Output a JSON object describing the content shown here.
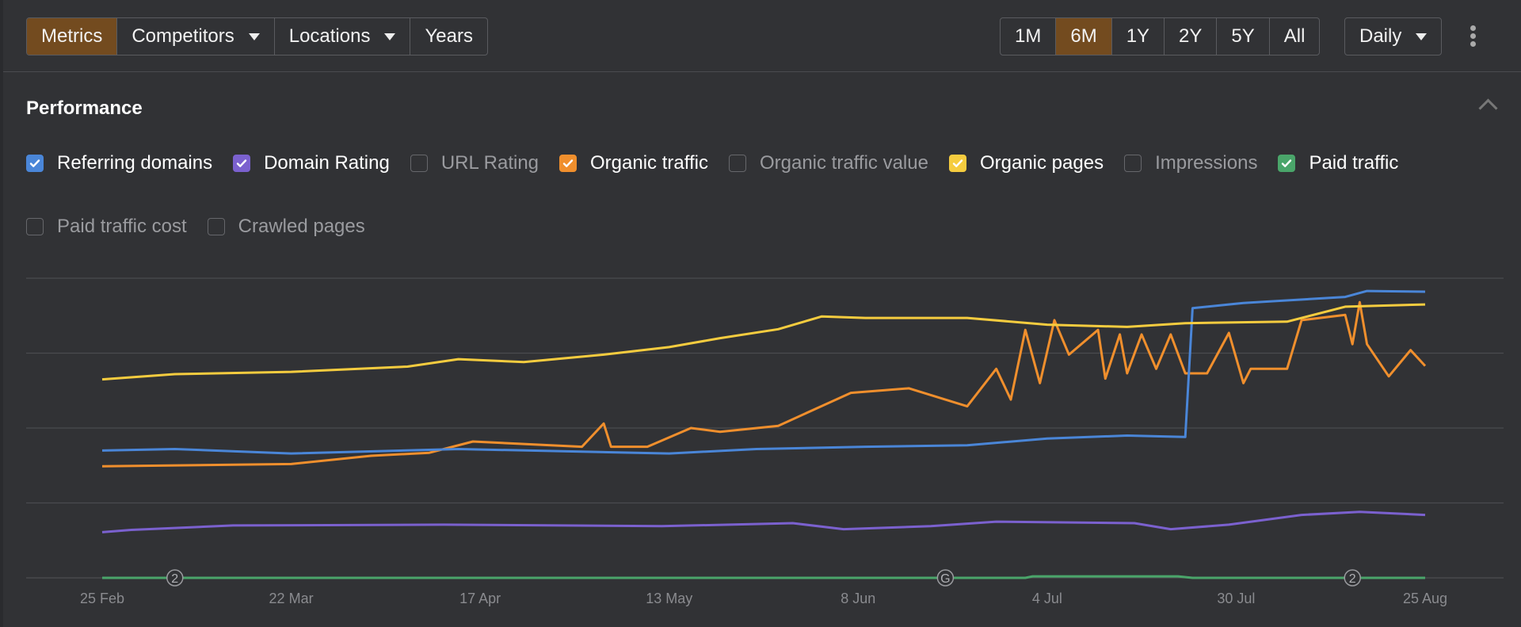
{
  "toolbar": {
    "left_buttons": [
      {
        "label": "Metrics",
        "active": true,
        "dropdown": false
      },
      {
        "label": "Competitors",
        "active": false,
        "dropdown": true
      },
      {
        "label": "Locations",
        "active": false,
        "dropdown": true
      },
      {
        "label": "Years",
        "active": false,
        "dropdown": false
      }
    ],
    "ranges": [
      {
        "label": "1M",
        "active": false
      },
      {
        "label": "6M",
        "active": true
      },
      {
        "label": "1Y",
        "active": false
      },
      {
        "label": "2Y",
        "active": false
      },
      {
        "label": "5Y",
        "active": false
      },
      {
        "label": "All",
        "active": false
      }
    ],
    "interval": "Daily",
    "more_icon": "kebab-vertical-icon"
  },
  "section": {
    "title": "Performance",
    "collapse_icon": "chevron-up-icon"
  },
  "metrics": [
    {
      "label": "Referring domains",
      "checked": true,
      "color": "#4a86d8"
    },
    {
      "label": "Domain Rating",
      "checked": true,
      "color": "#7b61cf"
    },
    {
      "label": "URL Rating",
      "checked": false,
      "color": ""
    },
    {
      "label": "Organic traffic",
      "checked": true,
      "color": "#f08f2d"
    },
    {
      "label": "Organic traffic value",
      "checked": false,
      "color": ""
    },
    {
      "label": "Organic pages",
      "checked": true,
      "color": "#f5cc3f"
    },
    {
      "label": "Impressions",
      "checked": false,
      "color": ""
    },
    {
      "label": "Paid traffic",
      "checked": true,
      "color": "#4aa56a"
    },
    {
      "label": "Paid traffic cost",
      "checked": false,
      "color": ""
    },
    {
      "label": "Crawled pages",
      "checked": false,
      "color": ""
    }
  ],
  "chart_data": {
    "type": "line",
    "grid": true,
    "y_axis_labels": false,
    "ylim": [
      0,
      4
    ],
    "x_ticks": [
      "25 Feb",
      "22 Mar",
      "17 Apr",
      "13 May",
      "8 Jun",
      "4 Jul",
      "30 Jul",
      "25 Aug"
    ],
    "series": [
      {
        "metric": "Organic pages",
        "color": "#f5cc3f",
        "points": [
          [
            "25 Feb",
            2.65
          ],
          [
            "6 Mar",
            2.72
          ],
          [
            "22 Mar",
            2.75
          ],
          [
            "7 Apr",
            2.82
          ],
          [
            "14 Apr",
            2.92
          ],
          [
            "23 Apr",
            2.88
          ],
          [
            "4 May",
            2.98
          ],
          [
            "13 May",
            3.08
          ],
          [
            "20 May",
            3.2
          ],
          [
            "28 May",
            3.32
          ],
          [
            "3 Jun",
            3.49
          ],
          [
            "9 Jun",
            3.47
          ],
          [
            "23 Jun",
            3.47
          ],
          [
            "4 Jul",
            3.38
          ],
          [
            "15 Jul",
            3.35
          ],
          [
            "23 Jul",
            3.4
          ],
          [
            "6 Aug",
            3.42
          ],
          [
            "14 Aug",
            3.62
          ],
          [
            "25 Aug",
            3.65
          ]
        ]
      },
      {
        "metric": "Referring domains",
        "color": "#4a86d8",
        "points": [
          [
            "25 Feb",
            1.7
          ],
          [
            "6 Mar",
            1.72
          ],
          [
            "22 Mar",
            1.66
          ],
          [
            "14 Apr",
            1.72
          ],
          [
            "13 May",
            1.66
          ],
          [
            "25 May",
            1.72
          ],
          [
            "9 Jun",
            1.75
          ],
          [
            "23 Jun",
            1.77
          ],
          [
            "4 Jul",
            1.86
          ],
          [
            "15 Jul",
            1.9
          ],
          [
            "23 Jul",
            1.88
          ],
          [
            "24 Jul",
            3.6
          ],
          [
            "31 Jul",
            3.67
          ],
          [
            "14 Aug",
            3.75
          ],
          [
            "17 Aug",
            3.83
          ],
          [
            "25 Aug",
            3.82
          ]
        ]
      },
      {
        "metric": "Organic traffic",
        "color": "#f08f2d",
        "points": [
          [
            "25 Feb",
            1.49
          ],
          [
            "22 Mar",
            1.52
          ],
          [
            "2 Apr",
            1.63
          ],
          [
            "10 Apr",
            1.67
          ],
          [
            "16 Apr",
            1.82
          ],
          [
            "1 May",
            1.75
          ],
          [
            "4 May",
            2.06
          ],
          [
            "5 May",
            1.75
          ],
          [
            "10 May",
            1.75
          ],
          [
            "16 May",
            2.0
          ],
          [
            "20 May",
            1.95
          ],
          [
            "28 May",
            2.03
          ],
          [
            "7 Jun",
            2.47
          ],
          [
            "15 Jun",
            2.53
          ],
          [
            "23 Jun",
            2.29
          ],
          [
            "27 Jun",
            2.79
          ],
          [
            "29 Jun",
            2.38
          ],
          [
            "1 Jul",
            3.31
          ],
          [
            "3 Jul",
            2.6
          ],
          [
            "5 Jul",
            3.44
          ],
          [
            "7 Jul",
            2.98
          ],
          [
            "11 Jul",
            3.31
          ],
          [
            "12 Jul",
            2.66
          ],
          [
            "14 Jul",
            3.25
          ],
          [
            "15 Jul",
            2.73
          ],
          [
            "17 Jul",
            3.25
          ],
          [
            "19 Jul",
            2.79
          ],
          [
            "21 Jul",
            3.25
          ],
          [
            "23 Jul",
            2.73
          ],
          [
            "26 Jul",
            2.73
          ],
          [
            "29 Jul",
            3.27
          ],
          [
            "31 Jul",
            2.6
          ],
          [
            "1 Aug",
            2.79
          ],
          [
            "6 Aug",
            2.79
          ],
          [
            "8 Aug",
            3.44
          ],
          [
            "14 Aug",
            3.51
          ],
          [
            "15 Aug",
            3.12
          ],
          [
            "16 Aug",
            3.68
          ],
          [
            "17 Aug",
            3.12
          ],
          [
            "20 Aug",
            2.69
          ],
          [
            "23 Aug",
            3.04
          ],
          [
            "25 Aug",
            2.83
          ]
        ]
      },
      {
        "metric": "Domain Rating",
        "color": "#7b61cf",
        "points": [
          [
            "25 Feb",
            0.61
          ],
          [
            "29 Feb",
            0.64
          ],
          [
            "14 Mar",
            0.7
          ],
          [
            "12 Apr",
            0.71
          ],
          [
            "12 May",
            0.69
          ],
          [
            "30 May",
            0.73
          ],
          [
            "6 Jun",
            0.65
          ],
          [
            "18 Jun",
            0.69
          ],
          [
            "27 Jun",
            0.75
          ],
          [
            "16 Jul",
            0.73
          ],
          [
            "21 Jul",
            0.65
          ],
          [
            "29 Jul",
            0.71
          ],
          [
            "8 Aug",
            0.84
          ],
          [
            "16 Aug",
            0.88
          ],
          [
            "25 Aug",
            0.84
          ]
        ]
      },
      {
        "metric": "Paid traffic",
        "color": "#4aa56a",
        "points": [
          [
            "25 Feb",
            0
          ],
          [
            "1 Jul",
            0
          ],
          [
            "2 Jul",
            0.02
          ],
          [
            "22 Jul",
            0.02
          ],
          [
            "24 Jul",
            0
          ],
          [
            "25 Aug",
            0
          ]
        ]
      }
    ],
    "annotations": [
      {
        "date": "6 Mar",
        "label": "2"
      },
      {
        "date": "20 Jun",
        "label": "G"
      },
      {
        "date": "15 Aug",
        "label": "2"
      }
    ]
  }
}
